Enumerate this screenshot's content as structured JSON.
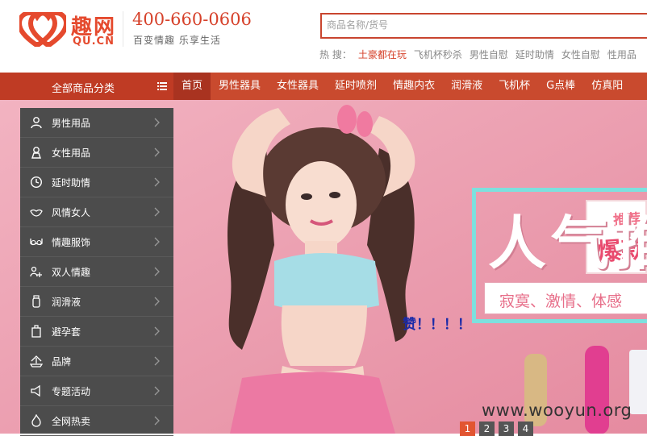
{
  "logo": {
    "cn": "趣网",
    "en": "QU.CN"
  },
  "header": {
    "phone": "400-660-0606",
    "slogan": "百变情趣 乐享生活"
  },
  "search": {
    "placeholder": "商品名称/货号",
    "hot_label": "热 搜：",
    "hot_keywords": [
      "土豪都在玩",
      "飞机杯秒杀",
      "男性自慰",
      "延时助情",
      "女性自慰",
      "性用品"
    ]
  },
  "nav": {
    "all_label": "全部商品分类",
    "items": [
      "首页",
      "男性器具",
      "女性器具",
      "延时喷剂",
      "情趣内衣",
      "润滑液",
      "飞机杯",
      "G点棒",
      "仿真阳"
    ]
  },
  "categories": [
    {
      "label": "男性用品",
      "icon": "male-icon"
    },
    {
      "label": "女性用品",
      "icon": "female-icon"
    },
    {
      "label": "延时助情",
      "icon": "clock-icon"
    },
    {
      "label": "风情女人",
      "icon": "lips-icon"
    },
    {
      "label": "情趣服饰",
      "icon": "bra-icon"
    },
    {
      "label": "双人情趣",
      "icon": "couple-icon"
    },
    {
      "label": "润滑液",
      "icon": "bottle-icon"
    },
    {
      "label": "避孕套",
      "icon": "box-icon"
    },
    {
      "label": "品牌",
      "icon": "brand-icon"
    },
    {
      "label": "专题活动",
      "icon": "megaphone-icon"
    },
    {
      "label": "全网热卖",
      "icon": "flame-icon"
    }
  ],
  "banner": {
    "promo_line1": "推荐",
    "promo_line2": "爆款",
    "big_title": "人气推",
    "tagline": "寂寞、激情、体感",
    "comment": "赞！！！！",
    "slides": [
      "1",
      "2",
      "3",
      "4"
    ],
    "active_slide": 0
  },
  "watermark": "www.wooyun.org",
  "colors": {
    "brand": "#c94a2e",
    "nav_active": "#a93320",
    "sidebar": "#4c4c4c",
    "banner_bg": "#ec9eaf"
  }
}
